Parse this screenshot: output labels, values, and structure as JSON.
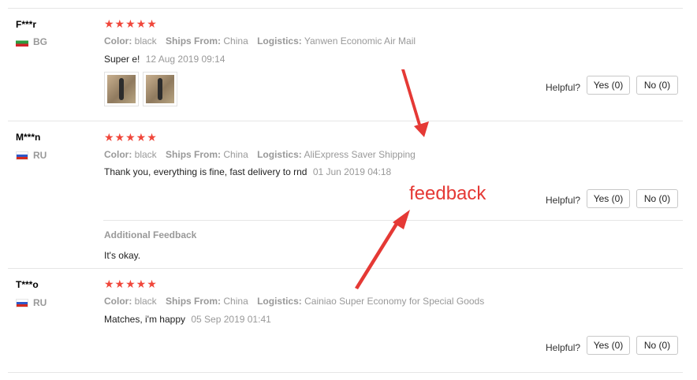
{
  "reviews": [
    {
      "name": "F***r",
      "country_code": "BG",
      "rating": 5,
      "stars": "★★★★★",
      "color_label": "Color:",
      "color_value": "black",
      "ships_label": "Ships From:",
      "ships_value": "China",
      "logistics_label": "Logistics:",
      "logistics_value": "Yanwen Economic Air Mail",
      "text": "Super e!",
      "date": "12 Aug 2019 09:14",
      "helpful_label": "Helpful?",
      "yes_label": "Yes (0)",
      "no_label": "No (0)"
    },
    {
      "name": "M***n",
      "country_code": "RU",
      "rating": 5,
      "stars": "★★★★★",
      "color_label": "Color:",
      "color_value": "black",
      "ships_label": "Ships From:",
      "ships_value": "China",
      "logistics_label": "Logistics:",
      "logistics_value": "AliExpress Saver Shipping",
      "text": "Thank you, everything is fine, fast delivery to rnd",
      "date": "01 Jun 2019 04:18",
      "helpful_label": "Helpful?",
      "yes_label": "Yes (0)",
      "no_label": "No (0)",
      "additional_feedback_label": "Additional Feedback",
      "additional_feedback_text": "It's okay."
    },
    {
      "name": "T***o",
      "country_code": "RU",
      "rating": 5,
      "stars": "★★★★★",
      "color_label": "Color:",
      "color_value": "black",
      "ships_label": "Ships From:",
      "ships_value": "China",
      "logistics_label": "Logistics:",
      "logistics_value": "Cainiao Super Economy for Special Goods",
      "text": "Matches, i'm happy",
      "date": "05 Sep 2019 01:41",
      "helpful_label": "Helpful?",
      "yes_label": "Yes (0)",
      "no_label": "No (0)"
    }
  ],
  "annotation": {
    "text": "feedback",
    "color": "#e53935"
  },
  "colors": {
    "star": "#f0473b",
    "muted": "#999999",
    "divider": "#e6e6e6"
  }
}
